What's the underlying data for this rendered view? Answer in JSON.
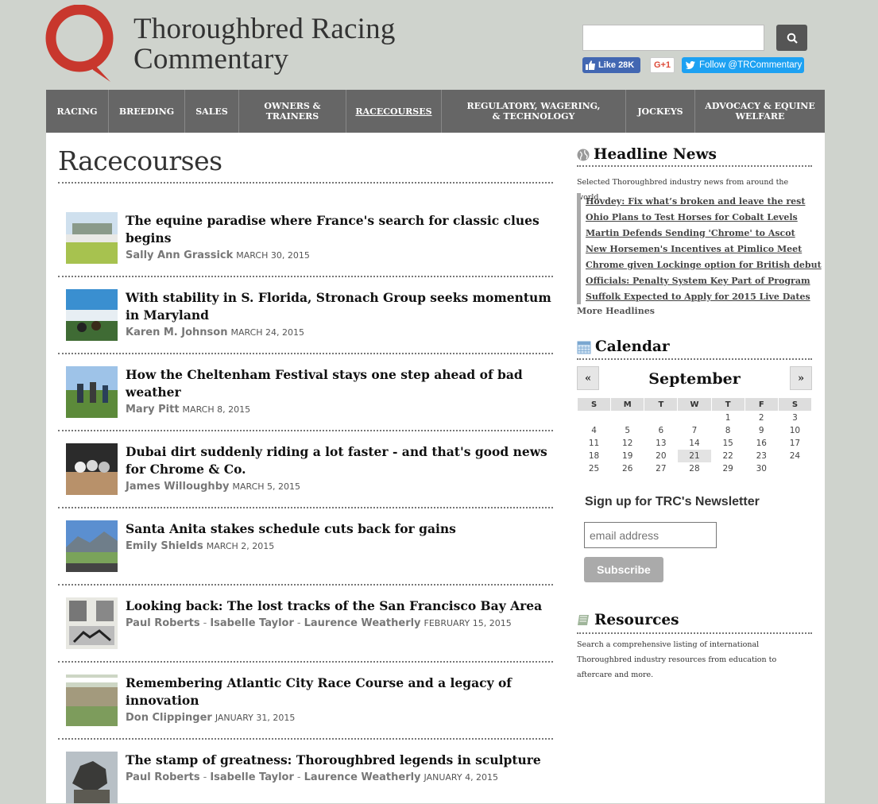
{
  "brand": {
    "line1": "Thoroughbred Racing",
    "line2": "Commentary",
    "accent": "#c8372d"
  },
  "social": {
    "fb": "Like 28K",
    "gplus": "G+1",
    "twitter": "Follow @TRCommentary"
  },
  "nav": [
    {
      "label": "RACING"
    },
    {
      "label": "BREEDING"
    },
    {
      "label": "SALES"
    },
    {
      "label": "OWNERS & TRAINERS"
    },
    {
      "label": "RACECOURSES",
      "active": true
    },
    {
      "label": "REGULATORY, WAGERING, & TECHNOLOGY"
    },
    {
      "label": "JOCKEYS"
    },
    {
      "label": "ADVOCACY & EQUINE WELFARE"
    }
  ],
  "page": {
    "title": "Racecourses"
  },
  "articles": [
    {
      "title": "The equine paradise where France's search for classic clues begins",
      "authors": [
        "Sally Ann Grassick"
      ],
      "date": "MARCH 30, 2015"
    },
    {
      "title": "With stability in S. Florida, Stronach Group seeks momentum in Maryland",
      "authors": [
        "Karen M. Johnson"
      ],
      "date": "MARCH 24, 2015"
    },
    {
      "title": "How the Cheltenham Festival stays one step ahead of bad weather",
      "authors": [
        "Mary Pitt"
      ],
      "date": "MARCH 8, 2015"
    },
    {
      "title": "Dubai dirt suddenly riding a lot faster - and that's good news for Chrome & Co.",
      "authors": [
        "James Willoughby"
      ],
      "date": "MARCH 5, 2015"
    },
    {
      "title": "Santa Anita stakes schedule cuts back for gains",
      "authors": [
        "Emily Shields"
      ],
      "date": "MARCH 2, 2015"
    },
    {
      "title": "Looking back: The lost tracks of the San Francisco Bay Area",
      "authors": [
        "Paul Roberts",
        "Isabelle Taylor",
        "Laurence Weatherly"
      ],
      "date": "FEBRUARY 15, 2015"
    },
    {
      "title": "Remembering Atlantic City Race Course and a legacy of innovation",
      "authors": [
        "Don Clippinger"
      ],
      "date": "JANUARY 31, 2015"
    },
    {
      "title": "The stamp of greatness: Thoroughbred legends in sculpture",
      "authors": [
        "Paul Roberts",
        "Isabelle Taylor",
        "Laurence Weatherly"
      ],
      "date": "JANUARY 4, 2015"
    }
  ],
  "sidebar": {
    "headline_title": "Headline News",
    "headline_desc": "Selected Thoroughbred industry news from around the world.",
    "headlines": [
      "Hovdey: Fix what’s broken and leave the rest",
      "Ohio Plans to Test Horses for Cobalt Levels",
      "Martin Defends Sending 'Chrome' to Ascot",
      "New Horsemen's Incentives at Pimlico Meet",
      "Chrome given Lockinge option for British debut",
      "Officials: Penalty System Key Part of Program",
      "Suffolk Expected to Apply for 2015 Live Dates"
    ],
    "more": "More Headlines",
    "calendar_title": "Calendar",
    "calendar": {
      "prev": "«",
      "next": "»",
      "month": "September",
      "days": [
        "S",
        "M",
        "T",
        "W",
        "T",
        "F",
        "S"
      ],
      "weeks": [
        [
          "",
          "",
          "",
          "",
          "1",
          "2",
          "3"
        ],
        [
          "4",
          "5",
          "6",
          "7",
          "8",
          "9",
          "10"
        ],
        [
          "11",
          "12",
          "13",
          "14",
          "15",
          "16",
          "17"
        ],
        [
          "18",
          "19",
          "20",
          "21",
          "22",
          "23",
          "24"
        ],
        [
          "25",
          "26",
          "27",
          "28",
          "29",
          "30",
          ""
        ]
      ],
      "today": "21"
    },
    "newsletter_title": "Sign up for TRC's Newsletter",
    "email_placeholder": "email address",
    "subscribe": "Subscribe",
    "resources_title": "Resources",
    "resources_desc": "Search a comprehensive listing of international Thoroughbred industry resources from education to aftercare and more."
  }
}
